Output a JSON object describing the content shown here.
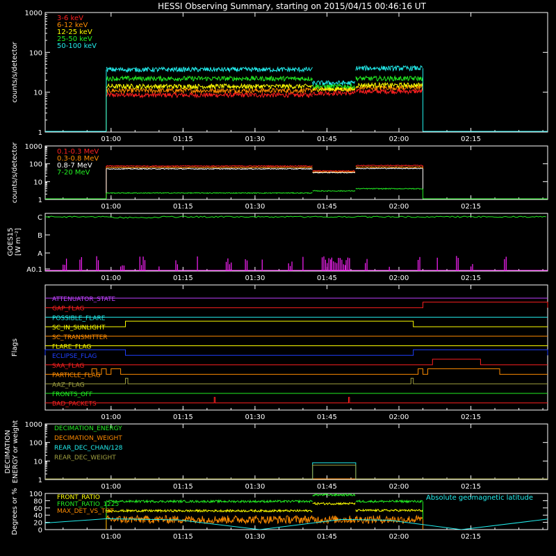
{
  "title": "HESSI Observing Summary, starting on 2015/04/15 00:46:16 UT",
  "time_ticks": [
    "01:00",
    "01:15",
    "01:30",
    "01:45",
    "02:00",
    "02:15"
  ],
  "colors": {
    "red": "#ff2020",
    "orange": "#ff8c00",
    "yellow": "#ffff00",
    "green": "#22ee22",
    "cyan": "#22eeee",
    "magenta": "#ff22ff",
    "blue": "#2040ff",
    "olive": "#a0a040",
    "white": "#ffffff",
    "purple": "#c040ff"
  },
  "chart_data": [
    {
      "type": "line",
      "id": "low-energy-rates",
      "ylabel": "counts/s/detector",
      "yscale": "log",
      "ylim": [
        1,
        1000
      ],
      "yticks": [
        "1",
        "10",
        "100",
        "1000"
      ],
      "data_window": [
        "00:59",
        "02:05"
      ],
      "series": [
        {
          "name": "3-6 keV",
          "color": "red",
          "segments": [
            [
              "00:59",
              "01:42",
              8.5
            ],
            [
              "01:42",
              "01:51",
              9.5
            ],
            [
              "01:51",
              "02:05",
              10.5
            ]
          ]
        },
        {
          "name": "6-12 keV",
          "color": "orange",
          "segments": [
            [
              "00:59",
              "01:42",
              11
            ],
            [
              "01:42",
              "01:51",
              12
            ],
            [
              "01:51",
              "02:05",
              13
            ]
          ]
        },
        {
          "name": "12-25 keV",
          "color": "yellow",
          "segments": [
            [
              "00:59",
              "01:42",
              14
            ],
            [
              "01:42",
              "01:51",
              12
            ],
            [
              "01:51",
              "02:05",
              15
            ]
          ]
        },
        {
          "name": "25-50 keV",
          "color": "green",
          "segments": [
            [
              "00:59",
              "01:42",
              22
            ],
            [
              "01:42",
              "01:51",
              14
            ],
            [
              "01:51",
              "02:05",
              22
            ]
          ]
        },
        {
          "name": "50-100 keV",
          "color": "cyan",
          "segments": [
            [
              "00:59",
              "01:42",
              37
            ],
            [
              "01:42",
              "01:51",
              17
            ],
            [
              "01:51",
              "02:05",
              40
            ]
          ]
        }
      ]
    },
    {
      "type": "line",
      "id": "high-energy-rates",
      "ylabel": "counts/s/detector",
      "yscale": "log",
      "ylim": [
        1,
        1000
      ],
      "yticks": [
        "1",
        "10",
        "100",
        "1000"
      ],
      "data_window": [
        "00:59",
        "02:05"
      ],
      "series": [
        {
          "name": "0.1-0.3 MeV",
          "color": "red",
          "segments": [
            [
              "00:59",
              "01:42",
              75
            ],
            [
              "01:42",
              "01:51",
              40
            ],
            [
              "01:51",
              "02:05",
              80
            ]
          ]
        },
        {
          "name": "0.3-0.8 MeV",
          "color": "orange",
          "segments": [
            [
              "00:59",
              "01:42",
              62
            ],
            [
              "01:42",
              "01:51",
              35
            ],
            [
              "01:51",
              "02:05",
              65
            ]
          ]
        },
        {
          "name": "0.8-7 MeV",
          "color": "white",
          "segments": [
            [
              "00:59",
              "01:42",
              52
            ],
            [
              "01:42",
              "01:51",
              32
            ],
            [
              "01:51",
              "02:05",
              55
            ]
          ]
        },
        {
          "name": "7-20 MeV",
          "color": "green",
          "segments": [
            [
              "00:59",
              "01:42",
              2.3
            ],
            [
              "01:42",
              "01:51",
              3
            ],
            [
              "01:51",
              "02:05",
              4
            ]
          ]
        }
      ]
    },
    {
      "type": "line",
      "id": "goes",
      "ylabel": "GOES15",
      "yunit": "[W m⁻²]",
      "yticks": [
        "A0.1",
        "A",
        "B",
        "C"
      ],
      "ylim": [
        0,
        3
      ]
    },
    {
      "type": "line",
      "id": "flags",
      "ylabel": "Flags",
      "flags": [
        {
          "name": "ATTENUATOR_STATE",
          "color": "purple",
          "high": []
        },
        {
          "name": "GAP_FLAG",
          "color": "red",
          "high": [
            [
              "02:05",
              "02:31"
            ]
          ]
        },
        {
          "name": "POSSIBLE_FLARE",
          "color": "cyan",
          "high": []
        },
        {
          "name": "SC_IN_SUNLIGHT",
          "color": "yellow",
          "high": [
            [
              "01:03",
              "02:03"
            ]
          ]
        },
        {
          "name": "SC_TRANSMITTER",
          "color": "orange",
          "high": []
        },
        {
          "name": "FLARE_FLAG",
          "color": "yellow",
          "high": []
        },
        {
          "name": "ECLIPSE_FLAG",
          "color": "blue",
          "high": [
            [
              "00:46",
              "01:03"
            ],
            [
              "02:03",
              "02:31"
            ]
          ]
        },
        {
          "name": "SAA_FLAG",
          "color": "red",
          "high": [
            [
              "02:07",
              "02:17"
            ]
          ]
        },
        {
          "name": "PARTICLE_FLAG",
          "color": "orange",
          "high": [
            [
              "00:56",
              "00:57"
            ],
            [
              "00:58",
              "00:59"
            ],
            [
              "01:00",
              "01:02"
            ],
            [
              "02:04",
              "02:05"
            ],
            [
              "02:06",
              "02:21"
            ]
          ]
        },
        {
          "name": "AAZ_FLAG",
          "color": "olive",
          "high": [
            [
              "01:03",
              "01:03.5"
            ],
            [
              "02:02.5",
              "02:03"
            ]
          ]
        },
        {
          "name": "FRONTS_OFF",
          "color": "green",
          "high": []
        },
        {
          "name": "BAD_PACKETS",
          "color": "red",
          "high": [
            [
              "01:21.5",
              "01:21.7"
            ],
            [
              "01:49.5",
              "01:49.7"
            ]
          ]
        }
      ]
    },
    {
      "type": "line",
      "id": "decimation",
      "ylabel": "DECIMATION ENERGY or weight",
      "yscale": "log",
      "ylim": [
        1,
        1000
      ],
      "yticks": [
        "1",
        "10",
        "100",
        "1000"
      ],
      "series": [
        {
          "name": "DECIMATION_ENERGY",
          "color": "green"
        },
        {
          "name": "DECIMATION_WEIGHT",
          "color": "orange"
        },
        {
          "name": "REAR_DEC_CHAN/128",
          "color": "cyan",
          "segments": [
            [
              "01:42",
              "01:51",
              8
            ]
          ]
        },
        {
          "name": "REAR_DEC_WEIGHT",
          "color": "olive",
          "segments": [
            [
              "01:42",
              "01:51",
              6
            ]
          ]
        }
      ]
    },
    {
      "type": "line",
      "id": "ratios",
      "ylabel": "Degrees or %",
      "ylim": [
        0,
        100
      ],
      "yticks": [
        "0",
        "20",
        "40",
        "60",
        "80",
        "100"
      ],
      "series": [
        {
          "name": "FRONT_RATIO",
          "color": "yellow",
          "segments": [
            [
              "00:59",
              "01:42",
              52
            ],
            [
              "01:42",
              "01:51",
              72
            ],
            [
              "01:51",
              "02:05",
              53
            ]
          ]
        },
        {
          "name": "FRONT_RATIO_1225",
          "color": "green",
          "segments": [
            [
              "00:59",
              "01:42",
              78
            ],
            [
              "01:42",
              "01:51",
              96
            ],
            [
              "01:51",
              "02:05",
              78
            ]
          ]
        },
        {
          "name": "MAX_DET_VS_TOT",
          "color": "orange",
          "segments": [
            [
              "00:59",
              "02:05",
              28
            ]
          ]
        },
        {
          "name": "Absolute geomagnetic latitude",
          "color": "cyan",
          "points": [
            [
              "00:46",
              18
            ],
            [
              "00:59",
              30
            ],
            [
              "01:14",
              27
            ],
            [
              "01:31",
              0
            ],
            [
              "01:48",
              28
            ],
            [
              "01:58",
              26
            ],
            [
              "02:13",
              0
            ],
            [
              "02:31",
              29
            ]
          ]
        }
      ]
    }
  ]
}
